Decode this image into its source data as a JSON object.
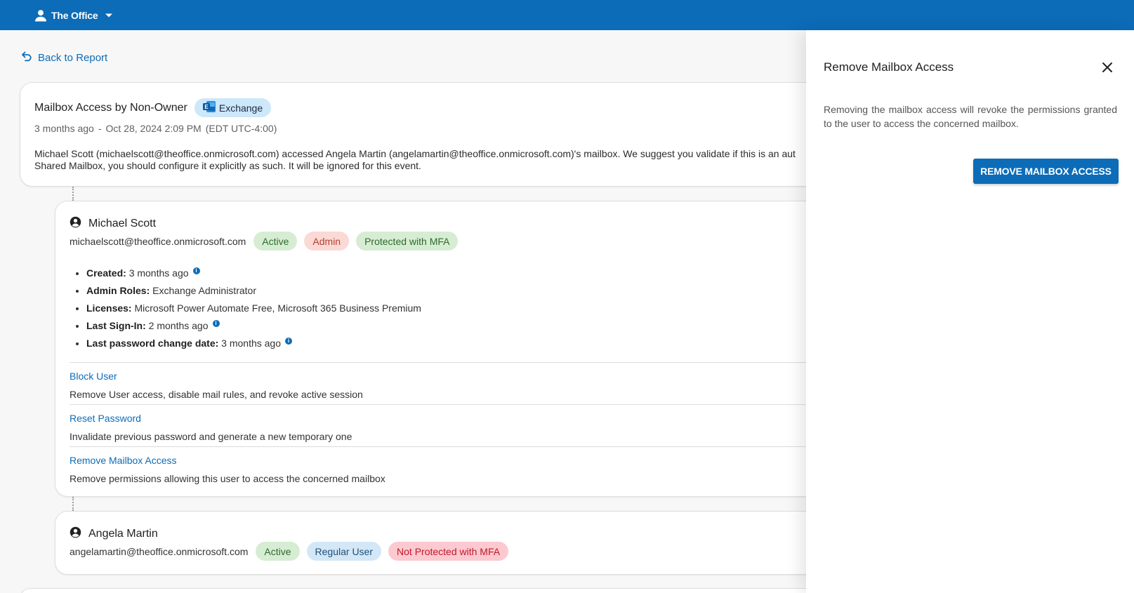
{
  "topbar": {
    "org_name": "The Office",
    "brand_color": "#0c6cb8"
  },
  "nav": {
    "back_label": "Back to Report"
  },
  "event": {
    "title": "Mailbox Access by Non-Owner",
    "source_chip": "Exchange",
    "relative_time": "3 months ago",
    "separator": "-",
    "timestamp": "Oct 28, 2024 2:09 PM",
    "timezone": "(EDT UTC-4:00)",
    "description_line1": "Michael Scott (michaelscott@theoffice.onmicrosoft.com) accessed Angela Martin (angelamartin@theoffice.onmicrosoft.com)'s mailbox. We suggest you validate if this is an aut",
    "description_line2": "Shared Mailbox, you should configure it explicitly as such. It will be ignored for this event."
  },
  "user1": {
    "name": "Michael Scott",
    "email": "michaelscott@theoffice.onmicrosoft.com",
    "chips": [
      "Active",
      "Admin",
      "Protected with MFA"
    ],
    "details": [
      {
        "label": "Created:",
        "value": "3 months ago",
        "info": true
      },
      {
        "label": "Admin Roles:",
        "value": "Exchange Administrator",
        "info": false
      },
      {
        "label": "Licenses:",
        "value": "Microsoft Power Automate Free, Microsoft 365 Business Premium",
        "info": false
      },
      {
        "label": "Last Sign-In:",
        "value": "2 months ago",
        "info": true
      },
      {
        "label": "Last password change date:",
        "value": "3 months ago",
        "info": true
      }
    ],
    "actions": [
      {
        "title": "Block User",
        "desc": "Remove User access, disable mail rules, and revoke active session"
      },
      {
        "title": "Reset Password",
        "desc": "Invalidate previous password and generate a new temporary one"
      },
      {
        "title": "Remove Mailbox Access",
        "desc": "Remove permissions allowing this user to access the concerned mailbox"
      }
    ]
  },
  "user2": {
    "name": "Angela Martin",
    "email": "angelamartin@theoffice.onmicrosoft.com",
    "chips": [
      "Active",
      "Regular User",
      "Not Protected with MFA"
    ]
  },
  "panel": {
    "title": "Remove Mailbox Access",
    "text": "Removing the mailbox access will revoke the permissions granted to the user to access the concerned mailbox.",
    "button": "REMOVE MAILBOX ACCESS"
  }
}
